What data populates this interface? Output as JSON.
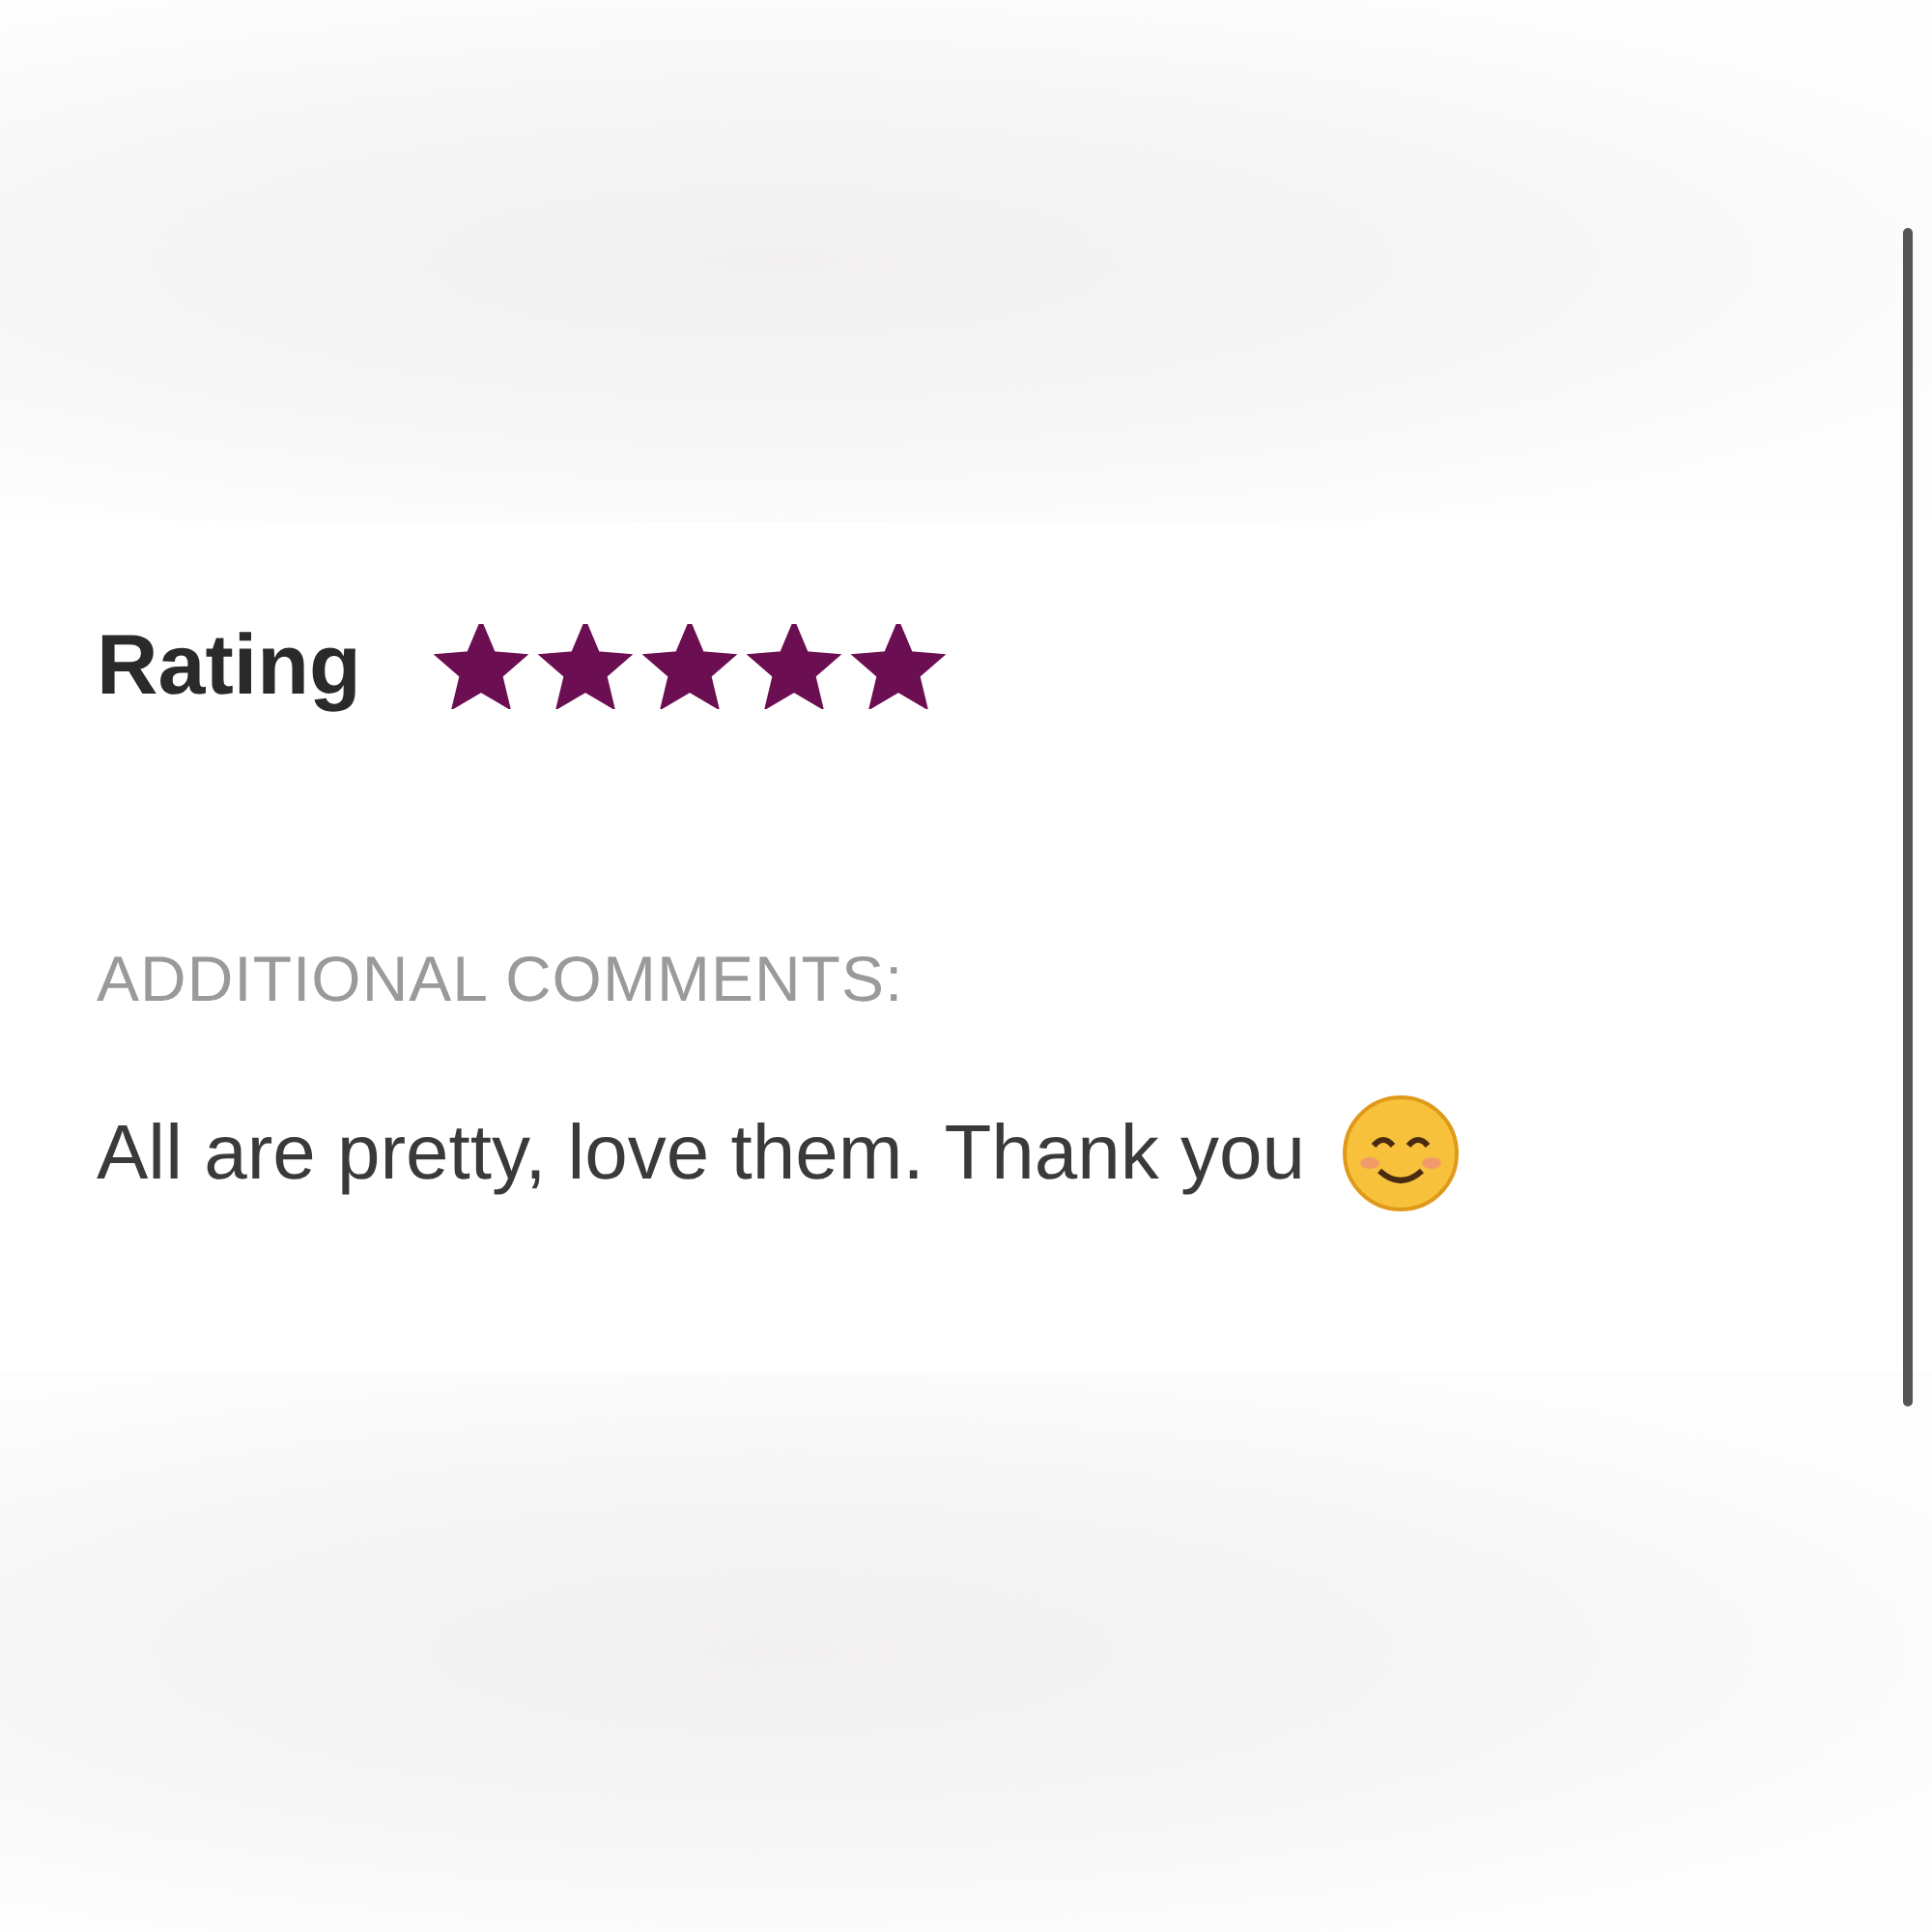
{
  "rating": {
    "label": "Rating",
    "stars": 5
  },
  "comments": {
    "label": "ADDITIONAL COMMENTS:",
    "text": "All are pretty, love them. Thank you"
  }
}
